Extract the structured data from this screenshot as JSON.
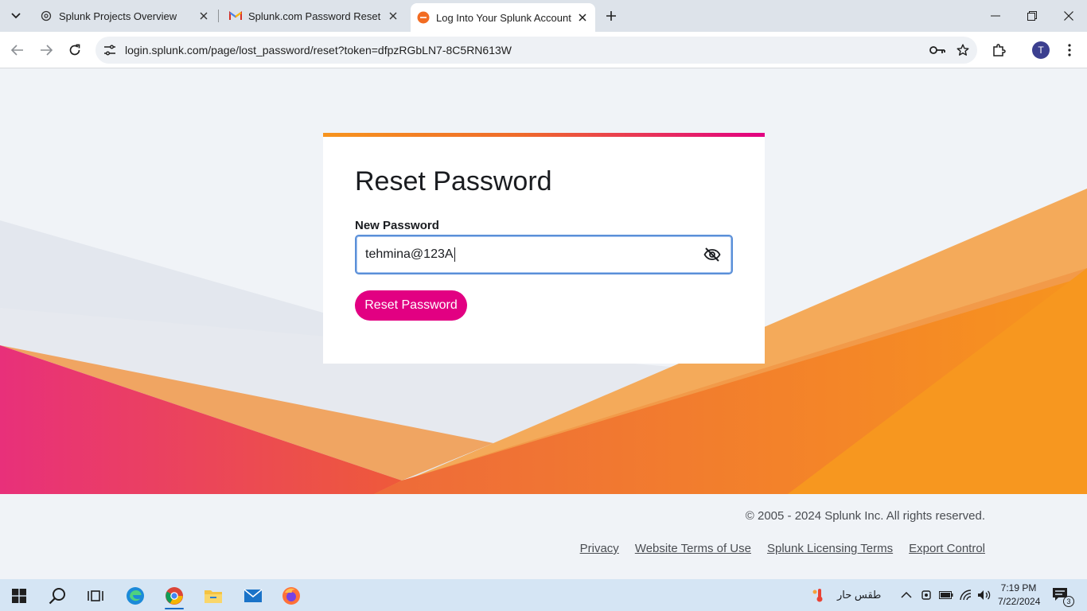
{
  "browser": {
    "tabs": [
      {
        "title": "Splunk Projects Overview",
        "icon": "chatgpt-icon"
      },
      {
        "title": "Splunk.com Password Reset Link",
        "icon": "gmail-icon"
      },
      {
        "title": "Log Into Your Splunk Account | Splunk",
        "icon": "splunk-icon",
        "active": true
      }
    ],
    "url": "login.splunk.com/page/lost_password/reset?token=dfpzRGbLN7-8C5RN613W",
    "profile_initial": "T"
  },
  "card": {
    "heading": "Reset Password",
    "field_label": "New Password",
    "field_value": "tehmina@123A",
    "button_label": "Reset Password"
  },
  "footer": {
    "copyright": "© 2005 - 2024 Splunk Inc. All rights reserved.",
    "links": [
      "Privacy",
      "Website Terms of Use",
      "Splunk Licensing Terms",
      "Export Control"
    ]
  },
  "taskbar": {
    "weather": "طقس حار",
    "time": "7:19 PM",
    "date": "7/22/2024",
    "notifications": "3"
  },
  "colors": {
    "accent_pink": "#e20082",
    "accent_orange": "#f7941e",
    "focus_blue": "#5a8fd8"
  }
}
